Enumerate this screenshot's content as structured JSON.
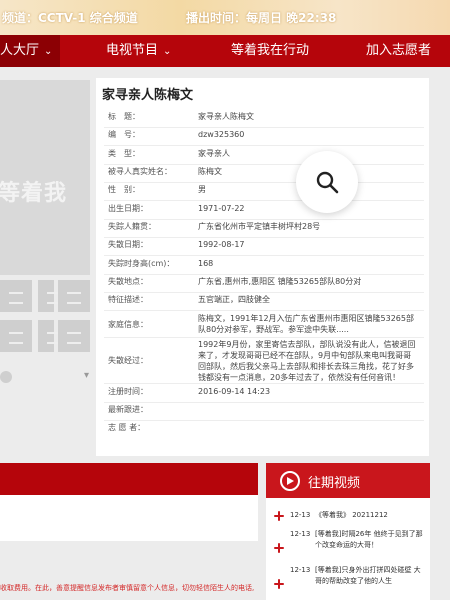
{
  "banner": {
    "channel": "频道：CCTV-1 综合频道",
    "airtime": "播出时间：每周日 晚22:38"
  },
  "nav": {
    "items": [
      {
        "label": "人大厅",
        "chevron": true
      },
      {
        "label": "电视节目",
        "chevron": true
      },
      {
        "label": "等着我在行动",
        "chevron": false
      },
      {
        "label": "加入志愿者",
        "chevron": false
      }
    ]
  },
  "poster": {
    "text": "等着我"
  },
  "detail": {
    "title": "家寻亲人陈梅文",
    "fields": [
      {
        "key": "标　题：",
        "value": "家寻亲人陈梅文"
      },
      {
        "key": "编　号：",
        "value": "dzw325360"
      },
      {
        "key": "类　型：",
        "value": "家寻亲人"
      },
      {
        "key": "被寻人真实姓名：",
        "value": "陈梅文"
      },
      {
        "key": "性　别：",
        "value": "男"
      },
      {
        "key": "出生日期：",
        "value": "1971-07-22"
      },
      {
        "key": "失踪人籍贯：",
        "value": "广东省化州市平定镇丰树坪村28号"
      },
      {
        "key": "失散日期：",
        "value": "1992-08-17"
      },
      {
        "key": "失踪时身高(cm)：",
        "value": "168"
      },
      {
        "key": "失散地点：",
        "value": "广东省,惠州市,惠阳区 镇隆53265部队80分对"
      },
      {
        "key": "特征描述：",
        "value": "五官端正，四肢健全"
      },
      {
        "key": "家庭信息：",
        "value": "陈梅文，1991年12月入伍广东省惠州市惠阳区镇隆53265部队80分对参军，野战军。参军途中失联....."
      },
      {
        "key": "失散经过：",
        "value": "1992年9月份，家里寄信去部队，部队说没有此人，信被退回来了，才发现哥哥已经不在部队，9月中旬部队来电叫我哥哥回部队，然后我父亲马上去部队和排长去珠三角找，花了好多钱都没有一点消息，20多年过去了，依然没有任何音讯！"
      },
      {
        "key": "注册时间：",
        "value": "2016-09-14 14:23"
      },
      {
        "key": "最新跟进：",
        "value": ""
      },
      {
        "key": "志 愿 者：",
        "value": ""
      }
    ]
  },
  "past_videos": {
    "title": "往期视频",
    "items": [
      {
        "date": "12-13",
        "title": "《等着我》 20211212"
      },
      {
        "date": "12-13",
        "title": "[等着我]时隔26年 他终于见到了那个改变命运的大哥！"
      },
      {
        "date": "12-13",
        "title": "[等着我]只身外出打拼四处碰壁 大哥的帮助改变了他的人生"
      }
    ]
  },
  "notice": "收取费用。在此，善意提醒信息发布者审慎留意个人信息，切勿轻信陌生人的电话,"
}
